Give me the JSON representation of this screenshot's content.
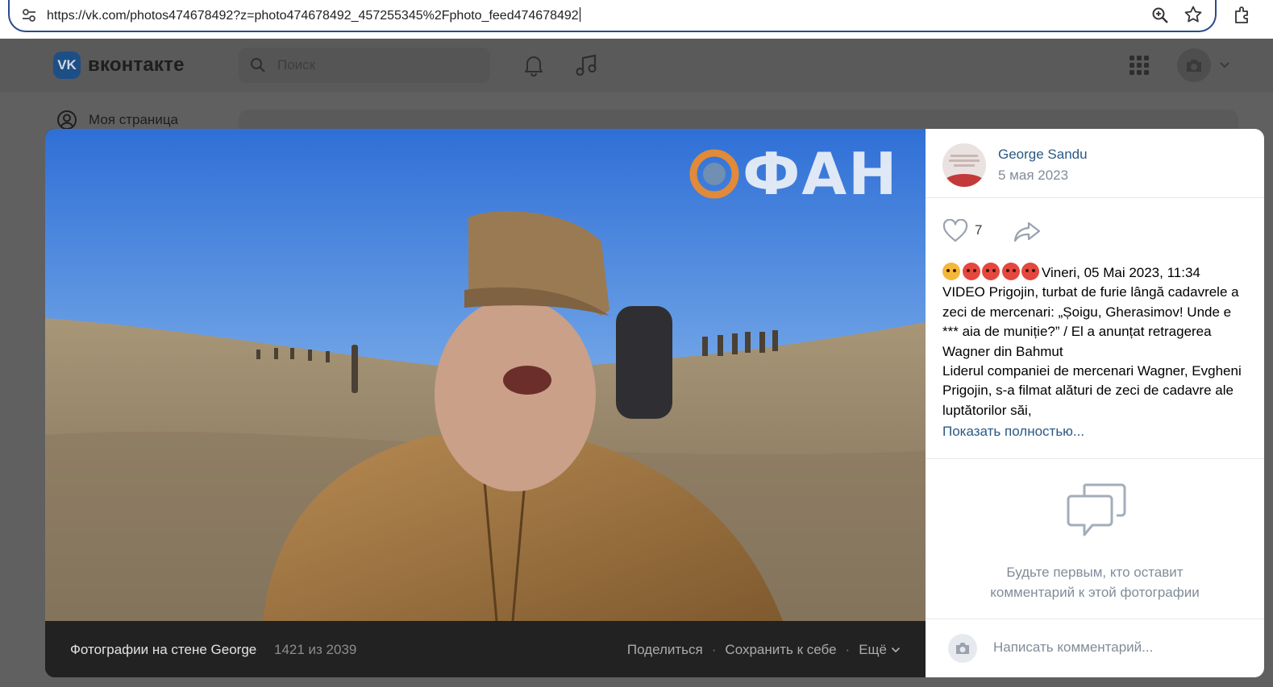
{
  "browser": {
    "url": "https://vk.com/photos474678492?z=photo474678492_457255345%2Fphoto_feed474678492",
    "icons": [
      "tune-icon",
      "zoom-icon",
      "star-icon",
      "extensions-icon"
    ]
  },
  "vk": {
    "logo_letters": "VK",
    "logo_text": "вконтакте",
    "search_placeholder": "Поиск",
    "sidebar_item": "Моя страница"
  },
  "viewer": {
    "watermark": "ФАН",
    "footer": {
      "album": "Фотографии на стене George",
      "counter": "1421 из 2039",
      "share": "Поделиться",
      "save": "Сохранить к себе",
      "more": "Ещё",
      "separator": "·"
    }
  },
  "post": {
    "author": "George Sandu",
    "date": "5 мая 2023",
    "likes": "7",
    "emoji": [
      "fearful-face",
      "angry-face",
      "angry-face",
      "angry-face",
      "angry-face"
    ],
    "text_lines": [
      "Vineri, 05 Mai 2023, 11:34",
      "VIDEO Prigojin, turbat de furie lângă cadavrele a",
      "zeci de mercenari: „Șoigu, Gherasimov! Unde e",
      "*** aia de muniție?” / El a anunțat retragerea",
      "Wagner din Bahmut",
      "Liderul companiei de mercenari Wagner, Evgheni",
      "Prigojin, s-a filmat alături de zeci de cadavre ale",
      "luptătorilor săi,"
    ],
    "show_more": "Показать полностью...",
    "empty_comments": [
      "Будьте первым, кто оставит",
      "комментарий к этой фотографии"
    ],
    "comment_placeholder": "Написать комментарий..."
  },
  "colors": {
    "link": "#2a5885",
    "muted": "#818c99",
    "address_border": "#2b4a8f",
    "viewer_footer": "#222222"
  }
}
